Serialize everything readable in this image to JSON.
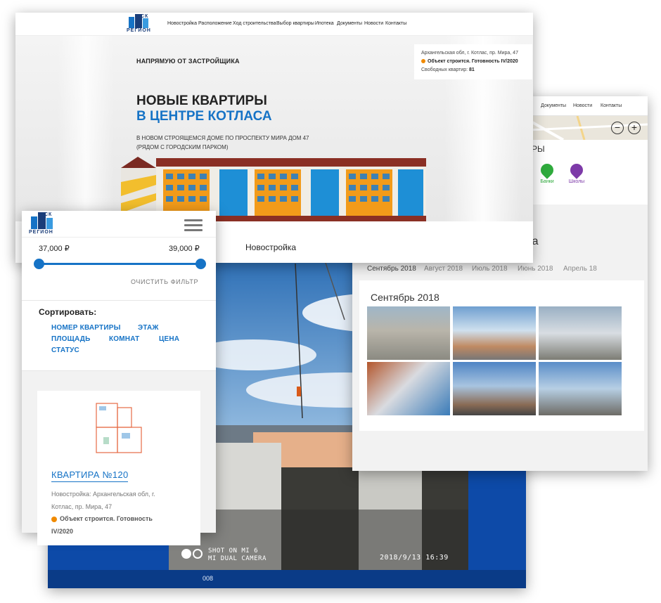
{
  "brand": {
    "logo_top": "СК",
    "logo_bottom": "РЕГИОН"
  },
  "colors": {
    "accent_blue": "#1673c6",
    "status_orange": "#f08a00",
    "panel_blue": "#0d4aa8"
  },
  "hero": {
    "nav": [
      "Новостройка",
      "Расположение",
      "Ход строительства",
      "Выбор квартиры",
      "Ипотека",
      "Документы",
      "Новости",
      "Контакты"
    ],
    "kicker": "НАПРЯМУЮ ОТ ЗАСТРОЙЩИКА",
    "title_line1": "НОВЫЕ КВАРТИРЫ",
    "title_line2": "В ЦЕНТРЕ КОТЛАСА",
    "subtitle_line1": "В НОВОМ СТРОЯЩЕМСЯ ДОМЕ ПО ПРОСПЕКТУ МИРА ДОМ 47",
    "subtitle_line2": "(РЯДОМ С ГОРОДСКИМ ПАРКОМ)",
    "info_address": "Архангельская обл, г. Котлас, пр. Мира, 47",
    "info_status": "Объект строится. Готовность IV/2020",
    "info_free_label": "Свободных квартир:",
    "info_free_count": "81",
    "footer_label": "Новостройка"
  },
  "gallery": {
    "nav": [
      "Документы",
      "Новости",
      "Контакты"
    ],
    "infra_title": "ТУРЫ",
    "infra_items": [
      {
        "label": "Банки",
        "icon": "dollar-icon",
        "color": "#2eaa3c"
      },
      {
        "label": "Школы",
        "icon": "book-icon",
        "color": "#7d3aa8"
      }
    ],
    "section_title": "тва",
    "tabs": [
      "Сентябрь 2018",
      "Август 2018",
      "Июль 2018",
      "Июнь 2018",
      "Апрель 18"
    ],
    "card_title": "Сентябрь 2018"
  },
  "photo": {
    "caption_line1": "SHOT ON MI 6",
    "caption_line2": "MI DUAL CAMERA",
    "timestamp": "2018/9/13  16:39",
    "bottom_label": "008"
  },
  "mobile": {
    "price_min": "37,000 ₽",
    "price_max": "39,000 ₽",
    "clear_filter": "ОЧИСТИТЬ ФИЛЬТР",
    "sort_label": "Сортировать:",
    "sort_options": [
      "НОМЕР КВАРТИРЫ",
      "ЭТАЖ",
      "ПЛОЩАДЬ",
      "КОМНАТ",
      "ЦЕНА",
      "СТАТУС"
    ],
    "apartment_title": "КВАРТИРА №120",
    "apartment_desc_line1": "Новостройка: Архангельская обл, г.",
    "apartment_desc_line2": "Котлас, пр. Мира, 47",
    "apartment_status_line1": "Объект строится. Готовность",
    "apartment_status_line2": "IV/2020"
  }
}
